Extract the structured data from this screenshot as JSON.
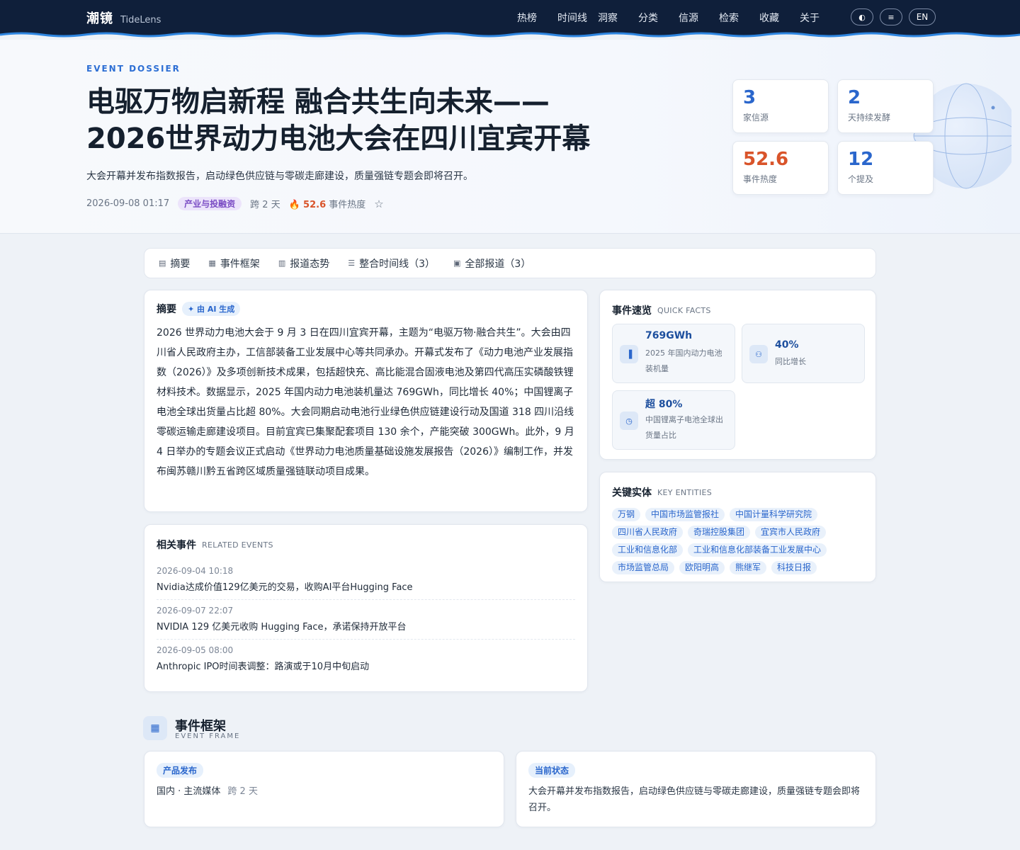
{
  "nav": {
    "brand_cn": "潮镜",
    "brand_en": "TideLens",
    "items": [
      "热榜",
      "时间线",
      "洞察",
      "分类",
      "信源",
      "检索",
      "收藏",
      "关于"
    ],
    "theme_btn": "◐",
    "menu_btn": "≡",
    "lang_btn": "EN"
  },
  "hero": {
    "kicker": "EVENT DOSSIER",
    "title": "电驱万物启新程 融合共生向未来——2026世界动力电池大会在四川宜宾开幕",
    "subtitle": "大会开幕并发布指数报告，启动绿色供应链与零碳走廊建设，质量强链专题会即将召开。",
    "date": "2026-09-08 01:17",
    "category": "产业与投融资",
    "span": "跨 2 天",
    "heat_value": "52.6",
    "heat_label": "事件热度",
    "star": "☆"
  },
  "stats": [
    {
      "value": "3",
      "label": "家信源"
    },
    {
      "value": "2",
      "label": "天持续发酵"
    },
    {
      "value": "52.6",
      "label": "事件热度"
    },
    {
      "value": "12",
      "label": "个提及"
    }
  ],
  "tabs": [
    {
      "icon": "▤",
      "label": "摘要"
    },
    {
      "icon": "▦",
      "label": "事件框架"
    },
    {
      "icon": "▥",
      "label": "报道态势"
    },
    {
      "icon": "☰",
      "label": "整合时间线（3）"
    },
    {
      "icon": "▣",
      "label": "全部报道（3）"
    }
  ],
  "summary": {
    "title": "摘要",
    "ai_tag": "✦ 由 AI 生成",
    "text": "2026 世界动力电池大会于 9 月 3 日在四川宜宾开幕，主题为“电驱万物·融合共生”。大会由四川省人民政府主办，工信部装备工业发展中心等共同承办。开幕式发布了《动力电池产业发展指数（2026）》及多项创新技术成果，包括超快充、高比能混合固液电池及第四代高压实磷酸铁锂材料技术。数据显示，2025 年国内动力电池装机量达 769GWh，同比增长 40%；中国锂离子电池全球出货量占比超 80%。大会同期启动电池行业绿色供应链建设行动及国道 318 四川沿线零碳运输走廊建设项目。目前宜宾已集聚配套项目 130 余个，产能突破 300GWh。此外，9 月 4 日举办的专题会议正式启动《世界动力电池质量基础设施发展报告（2026）》编制工作，并发布闽苏赣川黔五省跨区域质量强链联动项目成果。"
  },
  "related": {
    "title": "相关事件",
    "title_en": "RELATED EVENTS",
    "items": [
      {
        "date": "2026-09-04 10:18",
        "title": "Nvidia达成价值129亿美元的交易，收购AI平台Hugging Face"
      },
      {
        "date": "2026-09-07 22:07",
        "title": "NVIDIA 129 亿美元收购 Hugging Face，承诺保持开放平台"
      },
      {
        "date": "2026-09-05 08:00",
        "title": "Anthropic IPO时间表调整：路演或于10月中旬启动"
      }
    ]
  },
  "quick_facts": {
    "title": "事件速览",
    "title_en": "QUICK FACTS",
    "items": [
      {
        "icon": "bar-chart-icon",
        "glyph": "▐",
        "value": "769GWh",
        "label": "2025 年国内动力电池装机量"
      },
      {
        "icon": "users-icon",
        "glyph": "⚇",
        "value": "40%",
        "label": "同比增长"
      },
      {
        "icon": "clock-icon",
        "glyph": "◷",
        "value": "超 80%",
        "label": "中国锂离子电池全球出货量占比"
      }
    ]
  },
  "entities": {
    "title": "关键实体",
    "title_en": "KEY ENTITIES",
    "items": [
      "万钢",
      "中国市场监管报社",
      "中国计量科学研究院",
      "四川省人民政府",
      "奇瑞控股集团",
      "宜宾市人民政府",
      "工业和信息化部",
      "工业和信息化部装备工业发展中心",
      "市场监管总局",
      "欧阳明高",
      "熊继军",
      "科技日报"
    ]
  },
  "frame": {
    "title": "事件框架",
    "title_en": "EVENT FRAME",
    "left_tag": "产品发布",
    "left_text": "国内 · 主流媒体",
    "left_span": "跨 2 天",
    "right_tag": "当前状态",
    "right_text": "大会开幕并发布指数报告，启动绿色供应链与零碳走廊建设，质量强链专题会即将召开。"
  },
  "colors": {
    "nav_bg": "#0f1f3a",
    "accent": "#2a66cc",
    "heat": "#d9542a",
    "category_bg": "#ece4fb",
    "category_fg": "#7a4cc4"
  }
}
